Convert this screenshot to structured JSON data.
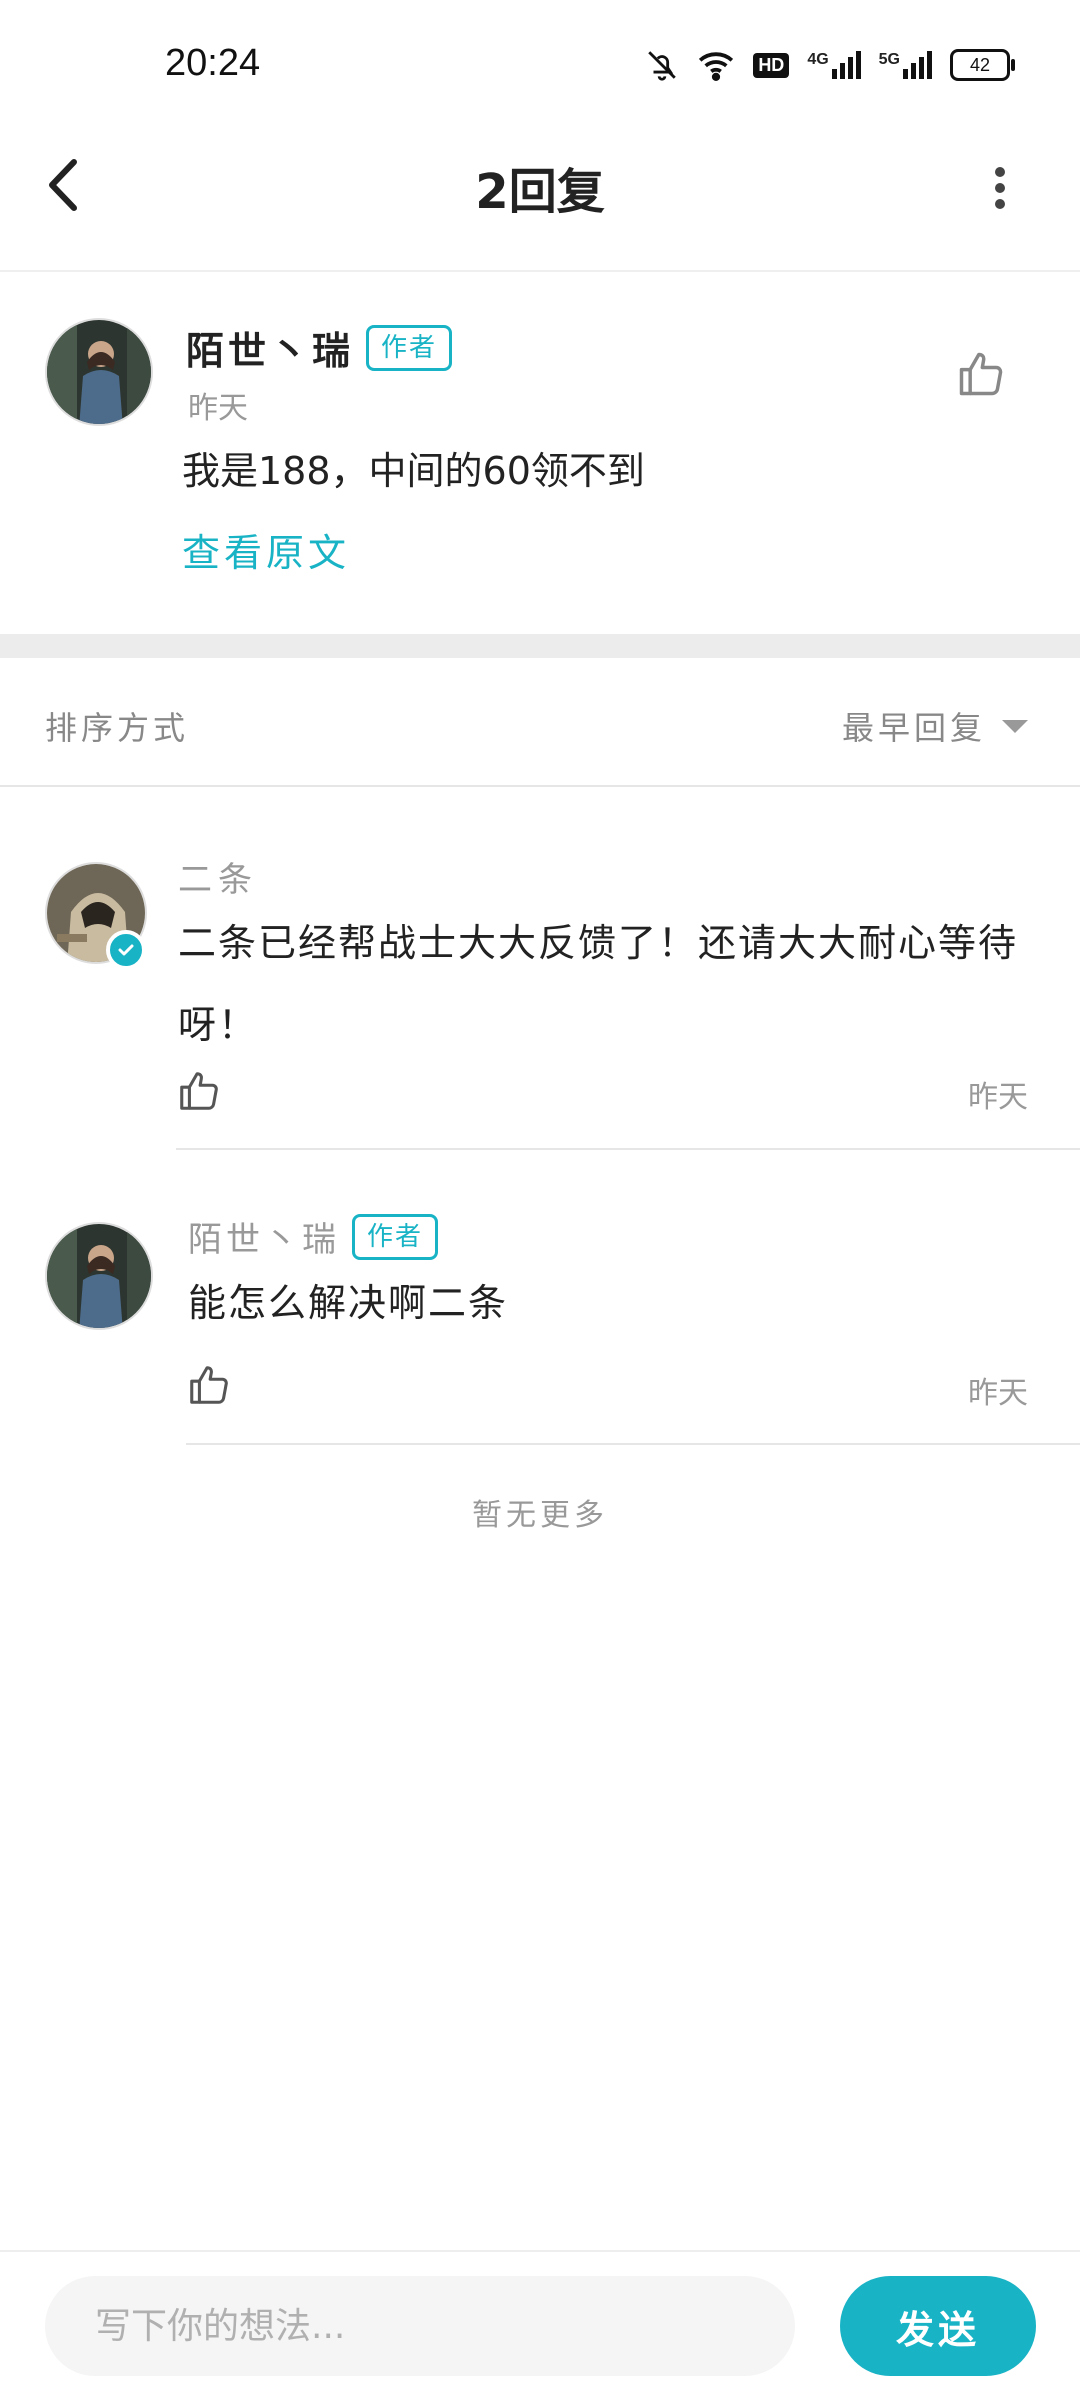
{
  "status_bar": {
    "time": "20:24",
    "battery": "42",
    "network_4g": "4G",
    "network_5g": "5G",
    "hd": "HD"
  },
  "header": {
    "title": "2回复"
  },
  "main_post": {
    "author": "陌世丶瑞",
    "author_tag": "作者",
    "time": "昨天",
    "text": "我是188，中间的60领不到",
    "view_original": "查看原文"
  },
  "sort": {
    "label": "排序方式",
    "selected": "最早回复"
  },
  "replies": [
    {
      "author": "二条",
      "text": "二条已经帮战士大大反馈了！还请大大耐心等待呀！",
      "time": "昨天",
      "verified": true
    },
    {
      "author": "陌世丶瑞",
      "author_tag": "作者",
      "text": "能怎么解决啊二条",
      "time": "昨天"
    }
  ],
  "footer_note": "暂无更多",
  "composer": {
    "placeholder": "写下你的想法...",
    "send_label": "发送"
  },
  "colors": {
    "accent": "#19b3c6"
  },
  "icons": [
    "back-icon",
    "more-icon",
    "thumbs-up-icon",
    "dropdown-arrow-icon",
    "verified-badge-icon",
    "bell-off-icon",
    "wifi-icon"
  ]
}
